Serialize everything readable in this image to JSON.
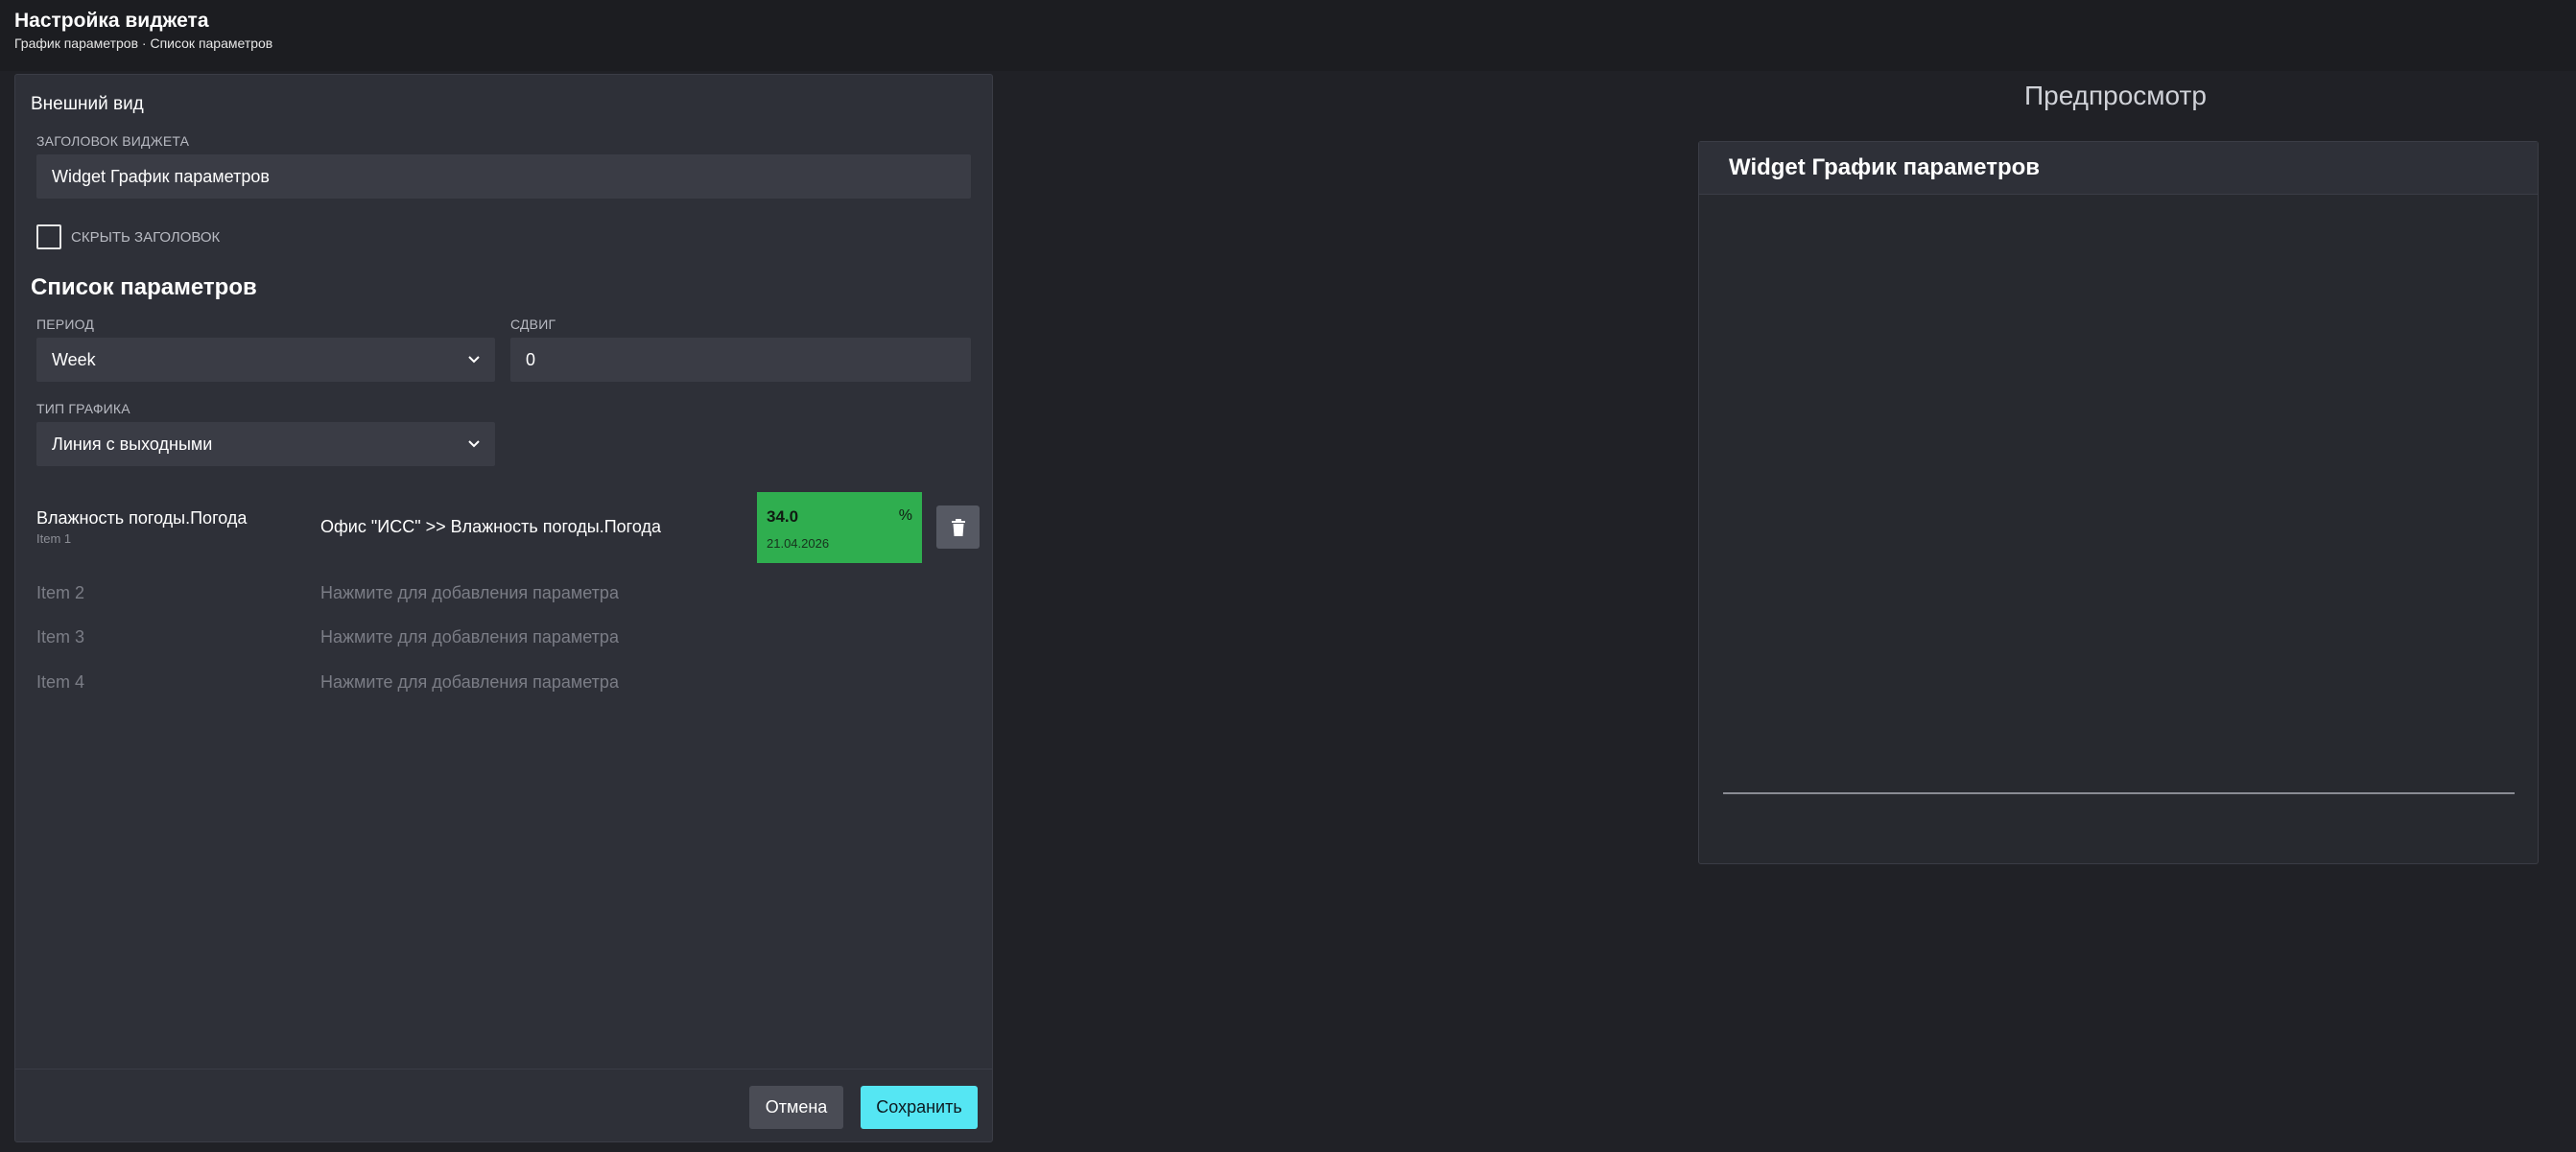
{
  "header": {
    "title": "Настройка виджета",
    "breadcrumb": "График параметров · Список параметров"
  },
  "appearance": {
    "section_title": "Внешний вид",
    "widget_title_label": "Заголовок виджета",
    "widget_title_value": "Widget График параметров",
    "hide_title_label": "Скрыть заголовок",
    "hide_title_checked": false
  },
  "params": {
    "section_title": "Список параметров",
    "period_label": "Период",
    "period_value": "Week",
    "shift_label": "Сдвиг",
    "shift_value": "0",
    "chart_type_label": "Тип графика",
    "chart_type_value": "Линия с выходными",
    "items": [
      {
        "name": "Влажность погоды.Погода",
        "sub": "Item 1",
        "path": "Офис \"ИСС\" >> Влажность погоды.Погода",
        "value": "34.0",
        "unit": "%",
        "date": "21.04.2026",
        "value_color": "#2fae4f"
      },
      {
        "name": "Item 2",
        "hint": "Нажмите для добавления параметра"
      },
      {
        "name": "Item 3",
        "hint": "Нажмите для добавления параметра"
      },
      {
        "name": "Item 4",
        "hint": "Нажмите для добавления параметра"
      }
    ]
  },
  "footer": {
    "cancel_label": "Отмена",
    "save_label": "Сохранить",
    "save_color": "#55e6f3"
  },
  "preview": {
    "heading": "Предпросмотр",
    "widget_title": "Widget График параметров"
  },
  "icons": {
    "dropdown": "chevron-down-icon",
    "delete": "trash-icon"
  }
}
